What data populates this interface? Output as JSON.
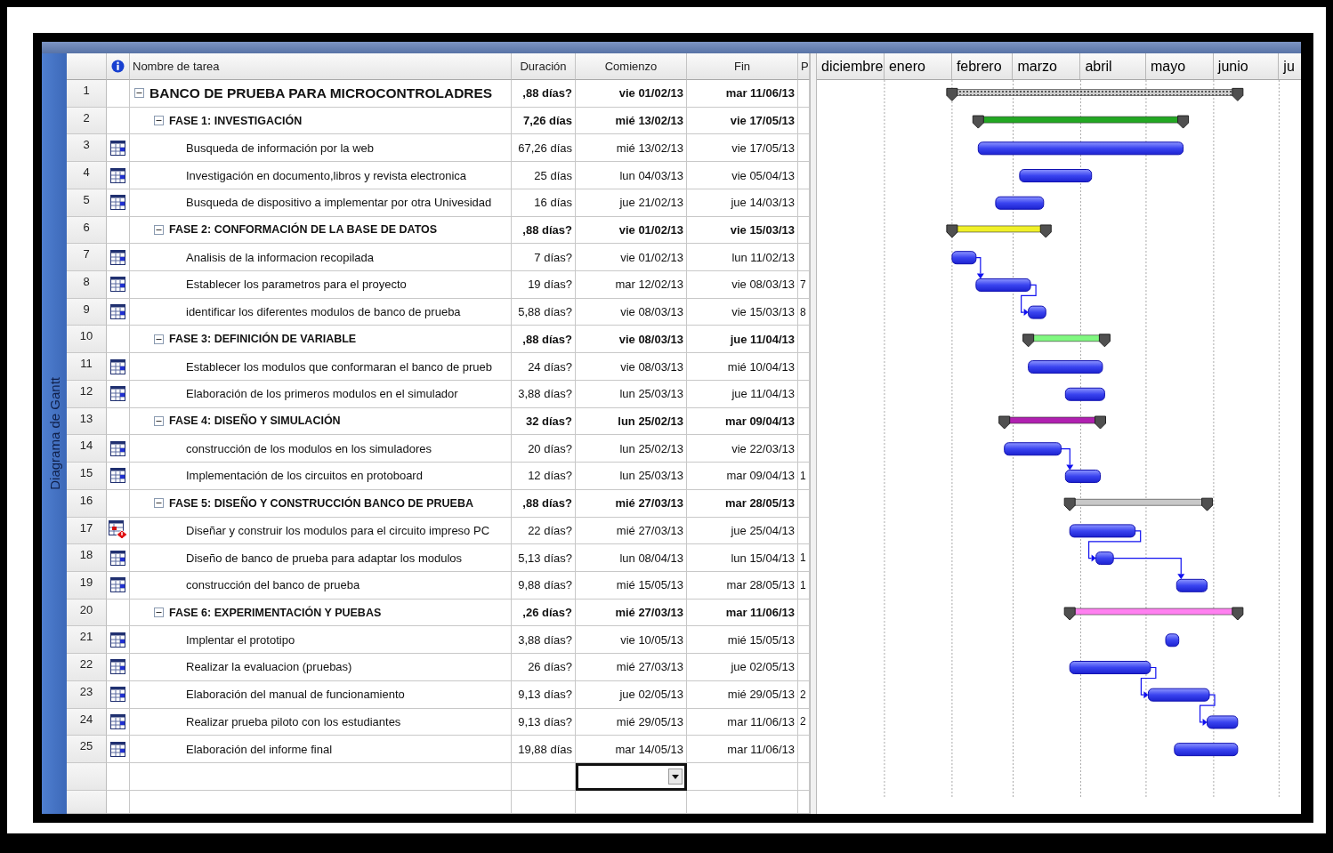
{
  "app": {
    "side_label": "Diagrama de Gantt"
  },
  "columns": {
    "name": "Nombre de tarea",
    "duration": "Duración",
    "start": "Comienzo",
    "finish": "Fin",
    "predecessors": "P"
  },
  "timeline": {
    "months": [
      "diciembre",
      "enero",
      "febrero",
      "marzo",
      "abril",
      "mayo",
      "junio",
      "ju"
    ]
  },
  "tasks": [
    {
      "id": "1",
      "kind": "project",
      "name": "BANCO DE PRUEBA PARA MICROCONTROLADRES",
      "duration": ",88 días?",
      "start": "vie 01/02/13",
      "finish": "mar 11/06/13",
      "expanded": true
    },
    {
      "id": "2",
      "kind": "summary",
      "name": "FASE 1: INVESTIGACIÓN",
      "duration": "7,26 días",
      "start": "mié 13/02/13",
      "finish": "vie 17/05/13",
      "expanded": true,
      "color": "#22a822"
    },
    {
      "id": "3",
      "kind": "task",
      "warning": false,
      "name": "Busqueda de información por la web",
      "duration": "67,26 días",
      "start": "mié 13/02/13",
      "finish": "vie 17/05/13",
      "linked": false
    },
    {
      "id": "4",
      "kind": "task",
      "warning": false,
      "name": "Investigación en documento,libros y revista electronica",
      "duration": "25 días",
      "start": "lun 04/03/13",
      "finish": "vie 05/04/13",
      "linked": false
    },
    {
      "id": "5",
      "kind": "task",
      "warning": false,
      "name": "Busqueda de dispositivo a implementar por otra Univesidad",
      "duration": "16 días",
      "start": "jue 21/02/13",
      "finish": "jue 14/03/13",
      "linked": false
    },
    {
      "id": "6",
      "kind": "summary",
      "name": "FASE 2: CONFORMACIÓN DE LA BASE DE DATOS",
      "duration": ",88 días?",
      "start": "vie 01/02/13",
      "finish": "vie 15/03/13",
      "expanded": true,
      "color": "#f0f028"
    },
    {
      "id": "7",
      "kind": "task",
      "warning": false,
      "name": "Analisis de la informacion recopilada",
      "duration": "7 días?",
      "start": "vie 01/02/13",
      "finish": "lun 11/02/13",
      "linked": false
    },
    {
      "id": "8",
      "kind": "task",
      "warning": false,
      "name": "Establecer los parametros para el proyecto",
      "duration": "19 días?",
      "start": "mar 12/02/13",
      "finish": "vie 08/03/13",
      "predecessor": "7",
      "linked": true
    },
    {
      "id": "9",
      "kind": "task",
      "warning": false,
      "name": "identificar los diferentes modulos de banco de prueba",
      "duration": "5,88 días?",
      "start": "vie 08/03/13",
      "finish": "vie 15/03/13",
      "predecessor": "8",
      "linked": true
    },
    {
      "id": "10",
      "kind": "summary",
      "name": "FASE 3: DEFINICIÓN DE VARIABLE",
      "duration": ",88 días?",
      "start": "vie 08/03/13",
      "finish": "jue 11/04/13",
      "expanded": true,
      "color": "#80f880"
    },
    {
      "id": "11",
      "kind": "task",
      "warning": false,
      "name": "Establecer los modulos que conformaran el banco de prueb",
      "duration": "24 días?",
      "start": "vie 08/03/13",
      "finish": "mié 10/04/13",
      "linked": false
    },
    {
      "id": "12",
      "kind": "task",
      "warning": false,
      "name": "Elaboración de los primeros modulos en el simulador",
      "duration": "3,88 días?",
      "start": "lun 25/03/13",
      "finish": "jue 11/04/13",
      "linked": false
    },
    {
      "id": "13",
      "kind": "summary",
      "name": "FASE 4: DISEÑO Y SIMULACIÓN",
      "duration": "32 días?",
      "start": "lun 25/02/13",
      "finish": "mar 09/04/13",
      "expanded": true,
      "color": "#b020b0"
    },
    {
      "id": "14",
      "kind": "task",
      "warning": false,
      "name": "construcción de los modulos en los simuladores",
      "duration": "20 días?",
      "start": "lun 25/02/13",
      "finish": "vie 22/03/13",
      "linked": false
    },
    {
      "id": "15",
      "kind": "task",
      "warning": false,
      "name": "Implementación de los circuitos en protoboard",
      "duration": "12 días?",
      "start": "lun 25/03/13",
      "finish": "mar 09/04/13",
      "predecessor": "1",
      "linked": true
    },
    {
      "id": "16",
      "kind": "summary",
      "name": "FASE 5: DISEÑO Y CONSTRUCCIÓN BANCO DE PRUEBA",
      "duration": ",88 días?",
      "start": "mié 27/03/13",
      "finish": "mar 28/05/13",
      "expanded": true,
      "color": "#c8c8c8"
    },
    {
      "id": "17",
      "kind": "task",
      "warning": true,
      "name": "Diseñar y construir los modulos para el circuito impreso PC",
      "duration": "22 días?",
      "start": "mié 27/03/13",
      "finish": "jue 25/04/13",
      "linked": false
    },
    {
      "id": "18",
      "kind": "task",
      "warning": false,
      "name": "Diseño de banco de prueba para adaptar los modulos",
      "duration": "5,13 días?",
      "start": "lun 08/04/13",
      "finish": "lun 15/04/13",
      "predecessor": "1",
      "linked": true
    },
    {
      "id": "19",
      "kind": "task",
      "warning": false,
      "name": "construcción del banco de prueba",
      "duration": "9,88 días?",
      "start": "mié 15/05/13",
      "finish": "mar 28/05/13",
      "predecessor": "1",
      "linked": true
    },
    {
      "id": "20",
      "kind": "summary",
      "name": "FASE 6: EXPERIMENTACIÓN Y PUEBAS",
      "duration": ",26 días?",
      "start": "mié 27/03/13",
      "finish": "mar 11/06/13",
      "expanded": true,
      "color": "#ff80f0"
    },
    {
      "id": "21",
      "kind": "task",
      "warning": false,
      "name": "Implentar el prototipo",
      "duration": "3,88 días?",
      "start": "vie 10/05/13",
      "finish": "mié 15/05/13",
      "linked": false
    },
    {
      "id": "22",
      "kind": "task",
      "warning": false,
      "name": "Realizar la evaluacion (pruebas)",
      "duration": "26 días?",
      "start": "mié 27/03/13",
      "finish": "jue 02/05/13",
      "linked": false
    },
    {
      "id": "23",
      "kind": "task",
      "warning": false,
      "name": "Elaboración del manual de funcionamiento",
      "duration": "9,13 días?",
      "start": "jue 02/05/13",
      "finish": "mié 29/05/13",
      "predecessor": "2",
      "linked": true
    },
    {
      "id": "24",
      "kind": "task",
      "warning": false,
      "name": "Realizar prueba piloto con los estudiantes",
      "duration": "9,13 días?",
      "start": "mié 29/05/13",
      "finish": "mar 11/06/13",
      "predecessor": "2",
      "linked": true
    },
    {
      "id": "25",
      "kind": "task",
      "warning": false,
      "name": "Elaboración del informe final",
      "duration": "19,88 días",
      "start": "mar 14/05/13",
      "finish": "mar 11/06/13",
      "linked": false
    }
  ]
}
